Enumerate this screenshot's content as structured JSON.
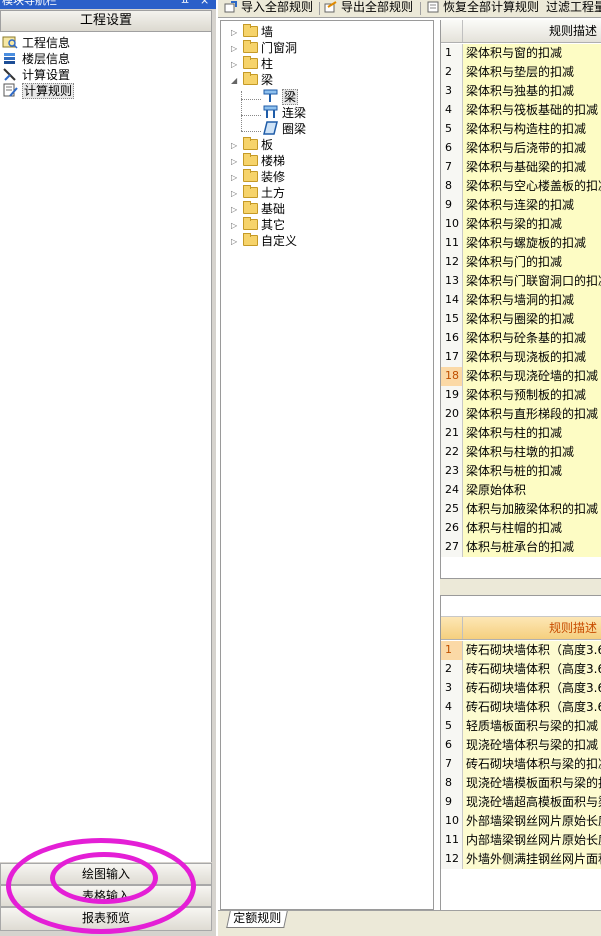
{
  "nav": {
    "title": "模块导航栏",
    "pin_glyph": "ㅍ",
    "close_glyph": "×",
    "header": "工程设置",
    "items": [
      {
        "label": "工程信息",
        "icon": "project-info-icon"
      },
      {
        "label": "楼层信息",
        "icon": "floor-info-icon"
      },
      {
        "label": "计算设置",
        "icon": "calc-settings-icon"
      },
      {
        "label": "计算规则",
        "icon": "calc-rules-icon"
      }
    ],
    "bottom_buttons": [
      "绘图输入",
      "表格输入",
      "报表预览"
    ]
  },
  "toolbar": {
    "import_all": "导入全部规则",
    "export_all": "导出全部规则",
    "restore_all": "恢复全部计算规则",
    "filter": "过滤工程量"
  },
  "tree": {
    "nodes": [
      {
        "label": "墙",
        "expanded": false
      },
      {
        "label": "门窗洞",
        "expanded": false
      },
      {
        "label": "柱",
        "expanded": false
      },
      {
        "label": "梁",
        "expanded": true
      },
      {
        "label": "板",
        "expanded": false
      },
      {
        "label": "楼梯",
        "expanded": false
      },
      {
        "label": "装修",
        "expanded": false
      },
      {
        "label": "土方",
        "expanded": false
      },
      {
        "label": "基础",
        "expanded": false
      },
      {
        "label": "其它",
        "expanded": false
      },
      {
        "label": "自定义",
        "expanded": false
      }
    ],
    "beam_children": [
      {
        "label": "梁",
        "icon": "beam-icon",
        "selected": true
      },
      {
        "label": "连梁",
        "icon": "coupling-beam-icon",
        "selected": false
      },
      {
        "label": "圈梁",
        "icon": "ring-beam-icon",
        "selected": false
      }
    ]
  },
  "grid1": {
    "header": "规则描述",
    "selected_row": 18,
    "rows": [
      "梁体积与窗的扣减",
      "梁体积与垫层的扣减",
      "梁体积与独基的扣减",
      "梁体积与筏板基础的扣减",
      "梁体积与构造柱的扣减",
      "梁体积与后浇带的扣减",
      "梁体积与基础梁的扣减",
      "梁体积与空心楼盖板的扣减",
      "梁体积与连梁的扣减",
      "梁体积与梁的扣减",
      "梁体积与螺旋板的扣减",
      "梁体积与门的扣减",
      "梁体积与门联窗洞口的扣减",
      "梁体积与墙洞的扣减",
      "梁体积与圈梁的扣减",
      "梁体积与砼条基的扣减",
      "梁体积与现浇板的扣减",
      "梁体积与现浇砼墙的扣减",
      "梁体积与预制板的扣减",
      "梁体积与直形梯段的扣减",
      "梁体积与柱的扣减",
      "梁体积与柱墩的扣减",
      "梁体积与桩的扣减",
      "梁原始体积",
      "体积与加腋梁体积的扣减",
      "体积与柱帽的扣减",
      "体积与桩承台的扣减"
    ]
  },
  "grid2": {
    "header": "规则描述",
    "selected_row": 1,
    "rows": [
      "砖石砌块墙体积（高度3.6",
      "砖石砌块墙体积（高度3.6",
      "砖石砌块墙体积（高度3.6",
      "砖石砌块墙体积（高度3.6",
      "轻质墙板面积与梁的扣减",
      "现浇砼墙体积与梁的扣减",
      "砖石砌块墙体积与梁的扣减",
      "现浇砼墙模板面积与梁的扣",
      "现浇砼墙超高模板面积与梁",
      "外部墙梁钢丝网片原始长度",
      "内部墙梁钢丝网片原始长度",
      "外墙外侧满挂钢丝网片面积"
    ]
  },
  "bottom_tab": "定额规则",
  "colors": {
    "annotation": "#e41fd6",
    "grid_cell": "#fdfcc4",
    "row_highlight": "#fbd9a6"
  }
}
